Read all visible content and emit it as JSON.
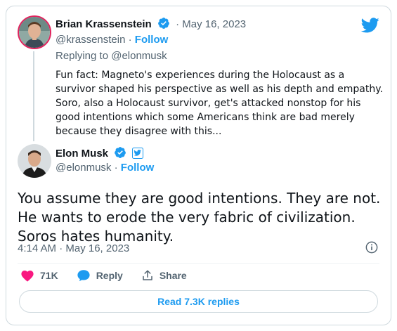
{
  "parent_tweet": {
    "author_name": "Brian Krassenstein",
    "date": "· May 16, 2023",
    "handle": "@krassenstein",
    "separator": "·",
    "follow_label": "Follow",
    "replying_to": "Replying to @elonmusk",
    "text": "Fun fact:  Magneto's experiences during the Holocaust as a survivor shaped his perspective as well as his depth and empathy.  Soro, also a Holocaust survivor, get's attacked nonstop for his good intentions which some Americans think are bad merely because they disagree with this..."
  },
  "main_tweet": {
    "author_name": "Elon Musk",
    "handle": "@elonmusk",
    "separator": "·",
    "follow_label": "Follow",
    "text": "You assume they are good intentions. They are not. He wants to erode the very fabric of civilization. Soros hates humanity.",
    "timestamp": "4:14 AM · May 16, 2023"
  },
  "actions": {
    "likes": "71K",
    "reply_label": "Reply",
    "share_label": "Share"
  },
  "read_replies_label": "Read 7.3K replies",
  "colors": {
    "accent": "#1d9bf0",
    "like": "#f91880",
    "text": "#0f1419",
    "muted": "#536471",
    "border": "#cfd9de"
  },
  "icons": [
    "twitter-bird-icon",
    "verified-badge-icon",
    "twitter-affiliate-icon",
    "info-icon",
    "heart-icon",
    "reply-bubble-icon",
    "share-icon"
  ]
}
